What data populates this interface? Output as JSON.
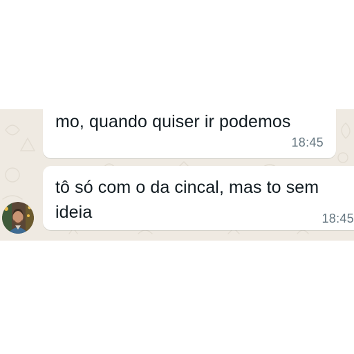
{
  "chat": {
    "messages": [
      {
        "text": "mo, quando quiser ir podemos",
        "time": "18:45"
      },
      {
        "text": "tô só com o da cincal, mas to sem ideia",
        "time": "18:45"
      }
    ]
  },
  "colors": {
    "chat_background": "#efeae2",
    "bubble_background": "#ffffff",
    "message_text": "#111b21",
    "timestamp_text": "#667781"
  },
  "icons": {
    "avatar": "contact-avatar-photo"
  }
}
